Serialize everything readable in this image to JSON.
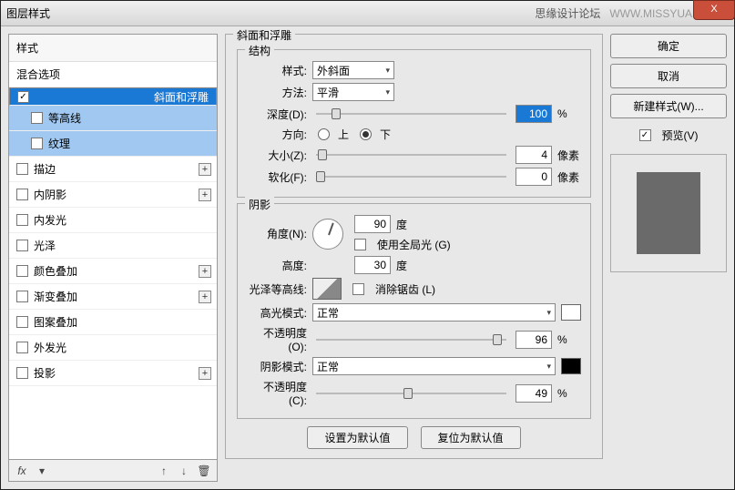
{
  "titlebar": {
    "title": "图层样式",
    "brand": "思缘设计论坛",
    "site": "WWW.MISSYUAN.COM",
    "close": "X"
  },
  "sidebar": {
    "hdr1": "样式",
    "hdr2": "混合选项",
    "items": [
      {
        "label": "斜面和浮雕",
        "checked": true,
        "sel": true
      },
      {
        "label": "等高线",
        "checked": false,
        "sub": true
      },
      {
        "label": "纹理",
        "checked": false,
        "sub": true
      },
      {
        "label": "描边",
        "checked": false,
        "plus": true
      },
      {
        "label": "内阴影",
        "checked": false,
        "plus": true
      },
      {
        "label": "内发光",
        "checked": false
      },
      {
        "label": "光泽",
        "checked": false
      },
      {
        "label": "颜色叠加",
        "checked": false,
        "plus": true
      },
      {
        "label": "渐变叠加",
        "checked": false,
        "plus": true
      },
      {
        "label": "图案叠加",
        "checked": false
      },
      {
        "label": "外发光",
        "checked": false
      },
      {
        "label": "投影",
        "checked": false,
        "plus": true
      }
    ],
    "footer": {
      "fx": "fx",
      "down": "▾",
      "up": "↑",
      "dn": "↓",
      "trash": "🗑"
    }
  },
  "panel": {
    "title": "斜面和浮雕",
    "structure": {
      "legend": "结构",
      "style": {
        "label": "样式:",
        "value": "外斜面"
      },
      "technique": {
        "label": "方法:",
        "value": "平滑"
      },
      "depth": {
        "label": "深度(D):",
        "value": "100",
        "unit": "%"
      },
      "direction": {
        "label": "方向:",
        "up": "上",
        "down": "下"
      },
      "size": {
        "label": "大小(Z):",
        "value": "4",
        "unit": "像素"
      },
      "soften": {
        "label": "软化(F):",
        "value": "0",
        "unit": "像素"
      }
    },
    "shading": {
      "legend": "阴影",
      "angle": {
        "label": "角度(N):",
        "value": "90",
        "unit": "度"
      },
      "global": {
        "label": "使用全局光 (G)"
      },
      "altitude": {
        "label": "高度:",
        "value": "30",
        "unit": "度"
      },
      "gloss": {
        "label": "光泽等高线:",
        "anti": "消除锯齿 (L)"
      },
      "hmode": {
        "label": "高光模式:",
        "value": "正常"
      },
      "hopacity": {
        "label": "不透明度(O):",
        "value": "96",
        "unit": "%"
      },
      "smode": {
        "label": "阴影模式:",
        "value": "正常"
      },
      "sopacity": {
        "label": "不透明度(C):",
        "value": "49",
        "unit": "%"
      }
    },
    "buttons": {
      "default": "设置为默认值",
      "reset": "复位为默认值"
    }
  },
  "right": {
    "ok": "确定",
    "cancel": "取消",
    "newstyle": "新建样式(W)...",
    "preview": {
      "label": "预览(V)"
    }
  }
}
